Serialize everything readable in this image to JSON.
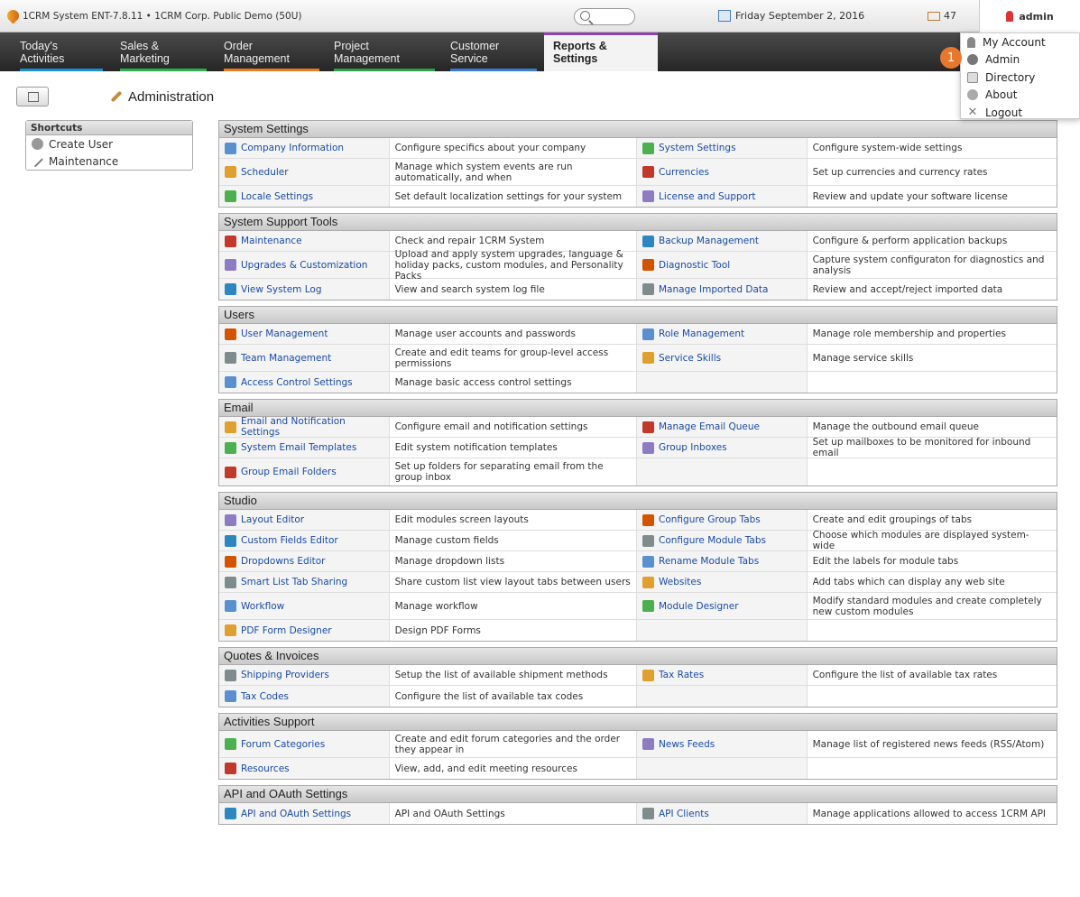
{
  "topbar": {
    "app_title": "1CRM System ENT-7.8.11 • 1CRM Corp. Public Demo (50U)",
    "date": "Friday September 2, 2016",
    "mail_count": "47",
    "user": "admin"
  },
  "nav": {
    "tabs": [
      {
        "label": "Today's Activities",
        "color": "#1a8fd8"
      },
      {
        "label": "Sales & Marketing",
        "color": "#2bb24c"
      },
      {
        "label": "Order Management",
        "color": "#e67e22"
      },
      {
        "label": "Project Management",
        "color": "#2ea04a"
      },
      {
        "label": "Customer Service",
        "color": "#3a7bd5"
      },
      {
        "label": "Reports & Settings",
        "color": "#8e44ad"
      }
    ]
  },
  "user_menu": {
    "items": [
      "My Account",
      "Admin",
      "Directory",
      "About",
      "Logout"
    ],
    "callout": "1"
  },
  "page": {
    "title": "Administration"
  },
  "shortcuts": {
    "header": "Shortcuts",
    "items": [
      "Create User",
      "Maintenance"
    ]
  },
  "sections": [
    {
      "title": "System Settings",
      "rows": [
        [
          "Company Information",
          "Configure specifics about your company",
          "System Settings",
          "Configure system-wide settings"
        ],
        [
          "Scheduler",
          "Manage which system events are run automatically, and when",
          "Currencies",
          "Set up currencies and currency rates"
        ],
        [
          "Locale Settings",
          "Set default localization settings for your system",
          "License and Support",
          "Review and update your software license"
        ]
      ]
    },
    {
      "title": "System Support Tools",
      "rows": [
        [
          "Maintenance",
          "Check and repair 1CRM System",
          "Backup Management",
          "Configure & perform application backups"
        ],
        [
          "Upgrades & Customization",
          "Upload and apply system upgrades, language & holiday packs, custom modules, and Personality Packs",
          "Diagnostic Tool",
          "Capture system configuraton for diagnostics and analysis"
        ],
        [
          "View System Log",
          "View and search system log file",
          "Manage Imported Data",
          "Review and accept/reject imported data"
        ]
      ]
    },
    {
      "title": "Users",
      "rows": [
        [
          "User Management",
          "Manage user accounts and passwords",
          "Role Management",
          "Manage role membership and properties"
        ],
        [
          "Team Management",
          "Create and edit teams for group-level access permissions",
          "Service Skills",
          "Manage service skills"
        ],
        [
          "Access Control Settings",
          "Manage basic access control settings",
          "",
          ""
        ]
      ]
    },
    {
      "title": "Email",
      "rows": [
        [
          "Email and Notification Settings",
          "Configure email and notification settings",
          "Manage Email Queue",
          "Manage the outbound email queue"
        ],
        [
          "System Email Templates",
          "Edit system notification templates",
          "Group Inboxes",
          "Set up mailboxes to be monitored for inbound email"
        ],
        [
          "Group Email Folders",
          "Set up folders for separating email from the group inbox",
          "",
          ""
        ]
      ]
    },
    {
      "title": "Studio",
      "rows": [
        [
          "Layout Editor",
          "Edit modules screen layouts",
          "Configure Group Tabs",
          "Create and edit groupings of tabs"
        ],
        [
          "Custom Fields Editor",
          "Manage custom fields",
          "Configure Module Tabs",
          "Choose which modules are displayed system-wide"
        ],
        [
          "Dropdowns Editor",
          "Manage dropdown lists",
          "Rename Module Tabs",
          "Edit the labels for module tabs"
        ],
        [
          "Smart List Tab Sharing",
          "Share custom list view layout tabs between users",
          "Websites",
          "Add tabs which can display any web site"
        ],
        [
          "Workflow",
          "Manage workflow",
          "Module Designer",
          "Modify standard modules and create completely new custom modules"
        ],
        [
          "PDF Form Designer",
          "Design PDF Forms",
          "",
          ""
        ]
      ]
    },
    {
      "title": "Quotes & Invoices",
      "rows": [
        [
          "Shipping Providers",
          "Setup the list of available shipment methods",
          "Tax Rates",
          "Configure the list of available tax rates"
        ],
        [
          "Tax Codes",
          "Configure the list of available tax codes",
          "",
          ""
        ]
      ]
    },
    {
      "title": "Activities Support",
      "rows": [
        [
          "Forum Categories",
          "Create and edit forum categories and the order they appear in",
          "News Feeds",
          "Manage list of registered news feeds (RSS/Atom)"
        ],
        [
          "Resources",
          "View, add, and edit meeting resources",
          "",
          ""
        ]
      ]
    },
    {
      "title": "API and OAuth Settings",
      "rows": [
        [
          "API and OAuth Settings",
          "API and OAuth Settings",
          "API Clients",
          "Manage applications allowed to access 1CRM API"
        ]
      ]
    }
  ]
}
